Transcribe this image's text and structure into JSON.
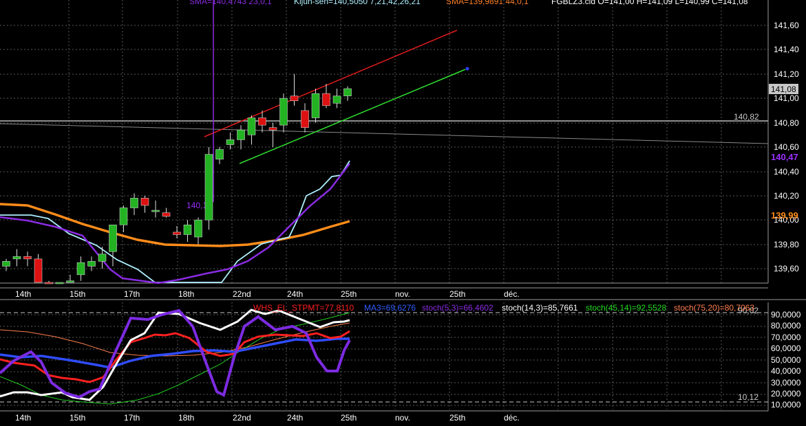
{
  "header": {
    "sma1": "SMA=140,4743  23,0,1",
    "kijun": "Kijun-sen=140,5050  7,21,42,26,21",
    "sma2": "SMA=139,9891  44,0,1",
    "ohlc": "FGBLZ3.cld O=141,00 H=141,09 L=140,99 C=141,08"
  },
  "price_axis": {
    "ticks": [
      "141,60",
      "141,40",
      "141,20",
      "141,00",
      "140,80",
      "140,60",
      "140,40",
      "140,20",
      "140,00",
      "139,80",
      "139,60"
    ],
    "last_price": "141,08",
    "level_line": "140,82",
    "sma1_value": "140,47",
    "sma2_value": "139,99",
    "annotation": "140,18"
  },
  "x_axis": {
    "labels": [
      "14th",
      "15th",
      "17th",
      "18th",
      "22nd",
      "24th",
      "25th",
      "nov.",
      "25th",
      "déc."
    ]
  },
  "lower_panel": {
    "legend": [
      {
        "text": "WHS_EL_STPMT=77,8110",
        "color": "#ff2020"
      },
      {
        "text": "MA3=69,6276",
        "color": "#2f5bff"
      },
      {
        "text": "stoch(5,3)=66,4602",
        "color": "#8a2be2"
      },
      {
        "text": "stoch(14,3)=85,7661",
        "color": "#ffffff"
      },
      {
        "text": "stoch(45,14)=92,5528",
        "color": "#22dd22"
      },
      {
        "text": "stoch(75,20)=80,7063",
        "color": "#ff7f50"
      }
    ],
    "ticks": [
      "90,0000",
      "80,0000",
      "70,0000",
      "60,0000",
      "50,0000",
      "40,0000",
      "30,0000",
      "20,0000",
      "10,0000"
    ],
    "upper_level": "90,02",
    "lower_level": "10,12"
  },
  "chart_data": {
    "type": "candlestick",
    "price_ylim": [
      139.5,
      141.7
    ],
    "candles": [
      {
        "o": 139.62,
        "h": 139.68,
        "l": 139.58,
        "c": 139.66
      },
      {
        "o": 139.68,
        "h": 139.76,
        "l": 139.62,
        "c": 139.7
      },
      {
        "o": 139.7,
        "h": 139.74,
        "l": 139.62,
        "c": 139.68
      },
      {
        "o": 139.68,
        "h": 139.72,
        "l": 139.4,
        "c": 139.42
      },
      {
        "o": 139.45,
        "h": 139.5,
        "l": 139.38,
        "c": 139.42
      },
      {
        "o": 139.4,
        "h": 139.48,
        "l": 139.36,
        "c": 139.4
      },
      {
        "o": 139.45,
        "h": 139.55,
        "l": 139.4,
        "c": 139.5
      },
      {
        "o": 139.55,
        "h": 139.7,
        "l": 139.5,
        "c": 139.65
      },
      {
        "o": 139.62,
        "h": 139.7,
        "l": 139.58,
        "c": 139.66
      },
      {
        "o": 139.66,
        "h": 139.78,
        "l": 139.6,
        "c": 139.72
      },
      {
        "o": 139.74,
        "h": 139.96,
        "l": 139.62,
        "c": 139.96
      },
      {
        "o": 139.96,
        "h": 140.12,
        "l": 139.9,
        "c": 140.1
      },
      {
        "o": 140.1,
        "h": 140.22,
        "l": 140.04,
        "c": 140.18
      },
      {
        "o": 140.18,
        "h": 140.2,
        "l": 140.06,
        "c": 140.12
      },
      {
        "o": 140.08,
        "h": 140.16,
        "l": 140.02,
        "c": 140.08
      },
      {
        "o": 140.06,
        "h": 140.1,
        "l": 140.02,
        "c": 140.03
      },
      {
        "o": 139.9,
        "h": 139.95,
        "l": 139.85,
        "c": 139.88
      },
      {
        "o": 139.88,
        "h": 140.0,
        "l": 139.82,
        "c": 139.96
      },
      {
        "o": 139.86,
        "h": 140.02,
        "l": 139.8,
        "c": 140.0
      },
      {
        "o": 140.0,
        "h": 140.6,
        "l": 139.92,
        "c": 140.54
      },
      {
        "o": 140.5,
        "h": 140.6,
        "l": 140.46,
        "c": 140.58
      },
      {
        "o": 140.62,
        "h": 140.72,
        "l": 140.58,
        "c": 140.66
      },
      {
        "o": 140.66,
        "h": 140.78,
        "l": 140.58,
        "c": 140.74
      },
      {
        "o": 140.7,
        "h": 140.86,
        "l": 140.62,
        "c": 140.84
      },
      {
        "o": 140.84,
        "h": 140.9,
        "l": 140.72,
        "c": 140.78
      },
      {
        "o": 140.76,
        "h": 140.8,
        "l": 140.6,
        "c": 140.74
      },
      {
        "o": 140.78,
        "h": 141.04,
        "l": 140.72,
        "c": 141.0
      },
      {
        "o": 141.02,
        "h": 141.2,
        "l": 140.94,
        "c": 140.98
      },
      {
        "o": 140.9,
        "h": 140.96,
        "l": 140.72,
        "c": 140.76
      },
      {
        "o": 140.84,
        "h": 141.08,
        "l": 140.8,
        "c": 141.04
      },
      {
        "o": 141.04,
        "h": 141.12,
        "l": 140.92,
        "c": 140.94
      },
      {
        "o": 140.96,
        "h": 141.08,
        "l": 140.92,
        "c": 141.02
      },
      {
        "o": 141.02,
        "h": 141.1,
        "l": 140.98,
        "c": 141.08
      }
    ],
    "stoch_ylim": [
      5,
      100
    ]
  }
}
